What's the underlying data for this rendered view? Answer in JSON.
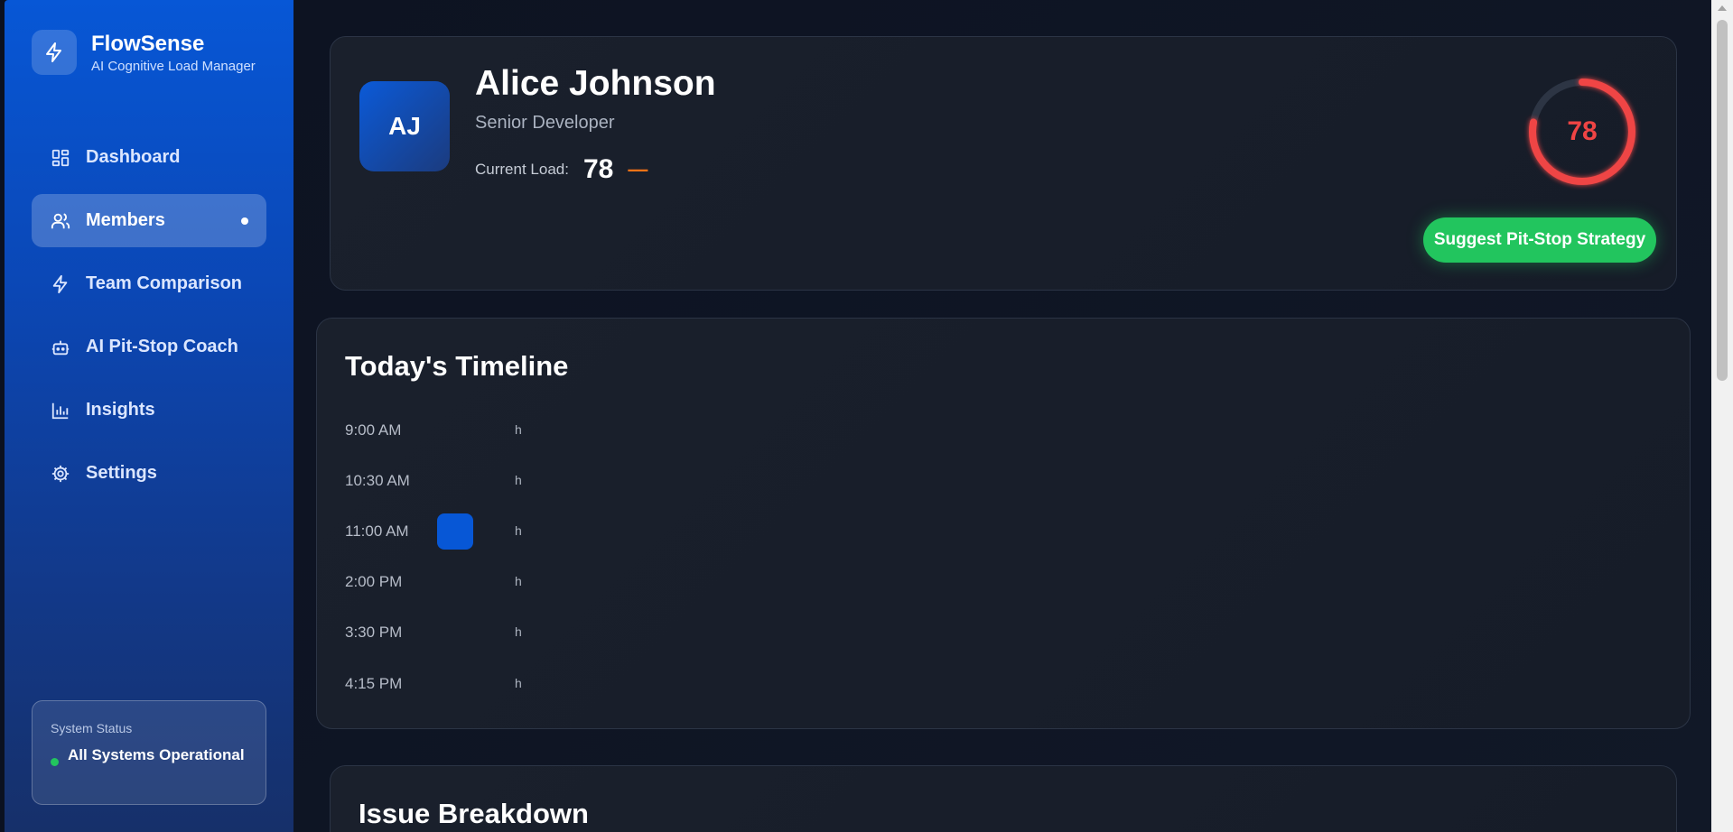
{
  "brand": {
    "name": "FlowSense",
    "subtitle": "AI Cognitive Load Manager",
    "icon": "bolt-icon"
  },
  "nav": [
    {
      "label": "Dashboard",
      "icon": "grid-icon",
      "active": false
    },
    {
      "label": "Members",
      "icon": "users-icon",
      "active": true
    },
    {
      "label": "Team Comparison",
      "icon": "bolt-icon",
      "active": false
    },
    {
      "label": "AI Pit-Stop Coach",
      "icon": "robot-icon",
      "active": false
    },
    {
      "label": "Insights",
      "icon": "bar-chart-icon",
      "active": false
    },
    {
      "label": "Settings",
      "icon": "gear-icon",
      "active": false
    }
  ],
  "system_status": {
    "title": "System Status",
    "text": "All Systems Operational",
    "color": "#22c55e"
  },
  "profile": {
    "initials": "AJ",
    "name": "Alice Johnson",
    "role": "Senior Developer",
    "load_label": "Current Load:",
    "load_value": "78",
    "trend": "—",
    "gauge_value": "78",
    "gauge_fraction": 0.78,
    "gauge_color": "#ef4444",
    "action_label": "Suggest Pit-Stop Strategy"
  },
  "timeline": {
    "title": "Today's Timeline",
    "rows": [
      {
        "time": "9:00 AM",
        "unit": "h",
        "has_block": false
      },
      {
        "time": "10:30 AM",
        "unit": "h",
        "has_block": false
      },
      {
        "time": "11:00 AM",
        "unit": "h",
        "has_block": true
      },
      {
        "time": "2:00 PM",
        "unit": "h",
        "has_block": false
      },
      {
        "time": "3:30 PM",
        "unit": "h",
        "has_block": false
      },
      {
        "time": "4:15 PM",
        "unit": "h",
        "has_block": false
      }
    ]
  },
  "issues": {
    "title": "Issue Breakdown"
  },
  "colors": {
    "accent": "#0757d6",
    "success": "#22c55e",
    "danger": "#ef4444",
    "warning": "#f97316"
  }
}
